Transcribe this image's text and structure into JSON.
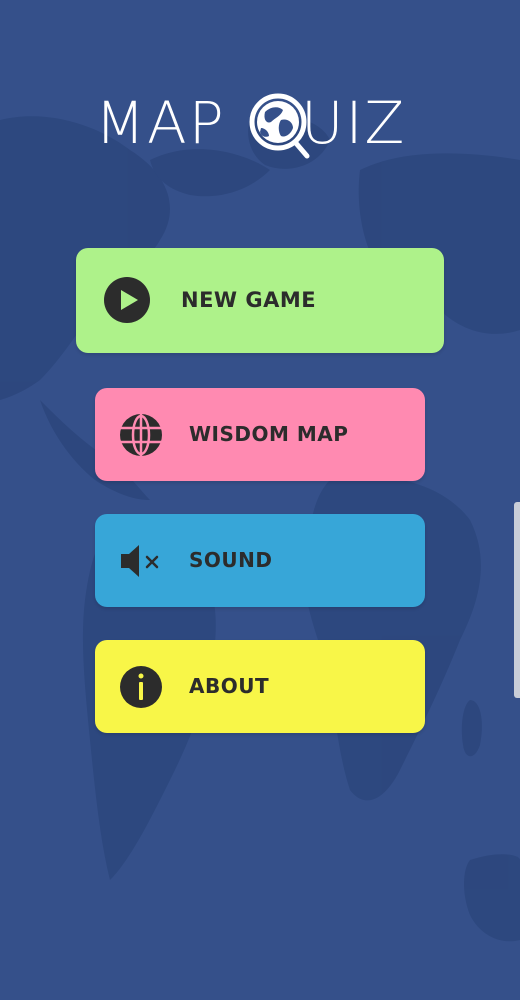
{
  "app": {
    "logo_left": "MAP",
    "logo_right": "UIZ",
    "logo_letter_q": "Q"
  },
  "menu": {
    "new_game": {
      "label": "NEW GAME",
      "icon": "play-icon",
      "color": "#aef28a"
    },
    "wisdom_map": {
      "label": "WISDOM MAP",
      "icon": "globe-icon",
      "color": "#ff8ab1"
    },
    "sound": {
      "label": "SOUND",
      "icon": "speaker-muted-icon",
      "color": "#37a6d8"
    },
    "about": {
      "label": "ABOUT",
      "icon": "info-icon",
      "color": "#f8f648"
    }
  },
  "colors": {
    "background": "#35508a",
    "map_landmass": "#2f4a80"
  }
}
